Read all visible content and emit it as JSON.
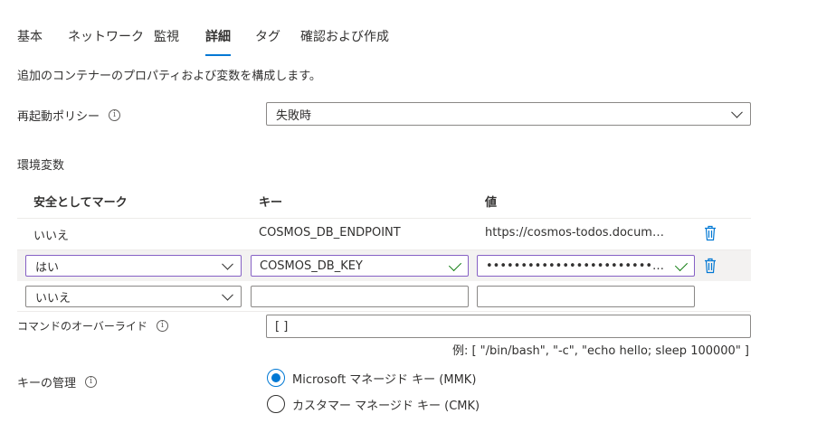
{
  "tabs": [
    {
      "label": "基本"
    },
    {
      "label": "ネットワーク"
    },
    {
      "label": "監視"
    },
    {
      "label": "詳細",
      "active": true
    },
    {
      "label": "タグ"
    },
    {
      "label": "確認および作成"
    }
  ],
  "description": "追加のコンテナーのプロパティおよび変数を構成します。",
  "restart_policy": {
    "label": "再起動ポリシー",
    "value": "失敗時"
  },
  "env": {
    "title": "環境変数",
    "headers": {
      "secure": "安全としてマーク",
      "key": "キー",
      "value": "値"
    },
    "rows": [
      {
        "secure": "いいえ",
        "key": "COSMOS_DB_ENDPOINT",
        "value": "https://cosmos-todos.docum…"
      },
      {
        "secure": "はい",
        "key": "COSMOS_DB_KEY",
        "value": "•••••••••••••••••••••••••…"
      },
      {
        "secure": "いいえ",
        "key": "",
        "value": ""
      }
    ]
  },
  "command_override": {
    "label": "コマンドのオーバーライド",
    "value": "[ ]",
    "hint": "例: [ \"/bin/bash\", \"-c\", \"echo hello; sleep 100000\" ]"
  },
  "key_management": {
    "label": "キーの管理",
    "options": [
      {
        "label": "Microsoft マネージド キー (MMK)",
        "checked": true
      },
      {
        "label": "カスタマー マネージド キー (CMK)",
        "checked": false
      }
    ]
  },
  "colors": {
    "accent": "#0078d4",
    "purple_border": "#8661c5",
    "check_green": "#107c10"
  },
  "icons": {
    "info": "info-icon",
    "delete": "trash-icon",
    "dropdown": "chevron-down-icon",
    "valid": "checkmark-icon"
  }
}
